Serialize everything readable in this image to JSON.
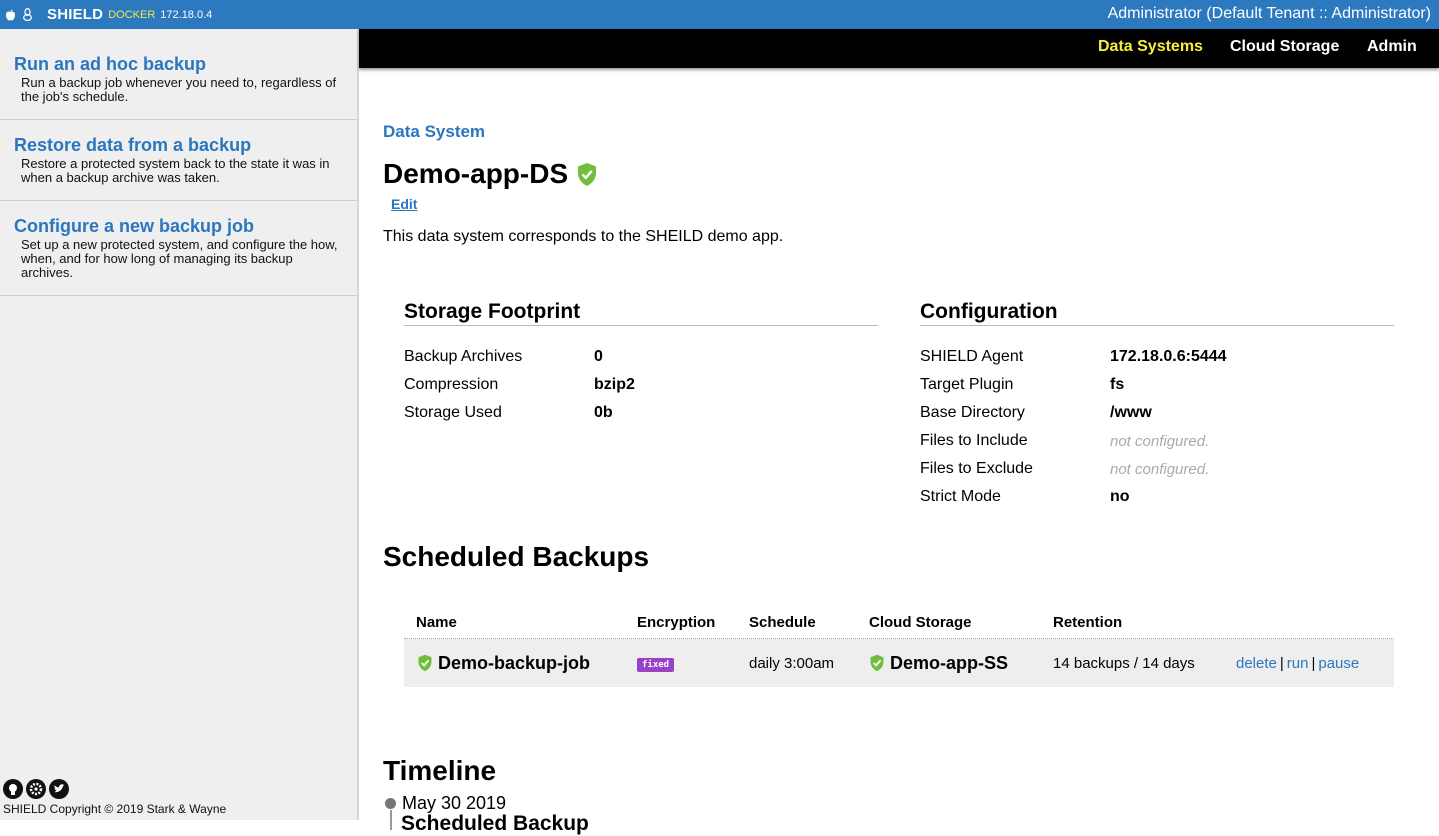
{
  "topbar": {
    "brand": "SHIELD",
    "env": "DOCKER",
    "ip": "172.18.0.4",
    "user": "Administrator (Default Tenant :: Administrator)"
  },
  "sidebar": {
    "items": [
      {
        "title": "Run an ad hoc backup",
        "desc": "Run a backup job whenever you need to, regardless of the job's schedule."
      },
      {
        "title": "Restore data from a backup",
        "desc": "Restore a protected system back to the state it was in when a backup archive was taken."
      },
      {
        "title": "Configure a new backup job",
        "desc": "Set up a new protected system, and configure the how, when, and for how long of managing its backup archives."
      }
    ],
    "footer": "SHIELD Copyright © 2019 Stark & Wayne"
  },
  "nav": {
    "data_systems": "Data Systems",
    "cloud_storage": "Cloud Storage",
    "admin": "Admin",
    "active_color": "#f7ee36"
  },
  "page": {
    "breadcrumb": "Data System",
    "title": "Demo-app-DS",
    "edit": "Edit",
    "description": "This data system corresponds to the SHEILD demo app."
  },
  "footprint": {
    "heading": "Storage Footprint",
    "rows": [
      {
        "k": "Backup Archives",
        "v": "0"
      },
      {
        "k": "Compression",
        "v": "bzip2"
      },
      {
        "k": "Storage Used",
        "v": "0b"
      }
    ]
  },
  "config": {
    "heading": "Configuration",
    "rows": [
      {
        "k": "SHIELD Agent",
        "v": "172.18.0.6:5444"
      },
      {
        "k": "Target Plugin",
        "v": "fs"
      },
      {
        "k": "Base Directory",
        "v": "/www"
      },
      {
        "k": "Files to Include",
        "v": "not configured."
      },
      {
        "k": "Files to Exclude",
        "v": "not configured."
      },
      {
        "k": "Strict Mode",
        "v": "no"
      }
    ]
  },
  "scheduled": {
    "heading": "Scheduled Backups",
    "columns": [
      "Name",
      "Encryption",
      "Schedule",
      "Cloud Storage",
      "Retention"
    ],
    "rows": [
      {
        "name": "Demo-backup-job",
        "encryption": "fixed",
        "schedule": "daily 3:00am",
        "storage": "Demo-app-SS",
        "retention": "14 backups / 14 days",
        "actions": {
          "delete": "delete",
          "run": "run",
          "pause": "pause"
        }
      }
    ]
  },
  "timeline": {
    "heading": "Timeline",
    "date": "May 30 2019",
    "next_title": "Scheduled Backup"
  },
  "colors": {
    "accent": "#2a77bf",
    "topbar": "#2c79c0",
    "badge": "#9b41c8",
    "shield": "#6fbf3c"
  }
}
